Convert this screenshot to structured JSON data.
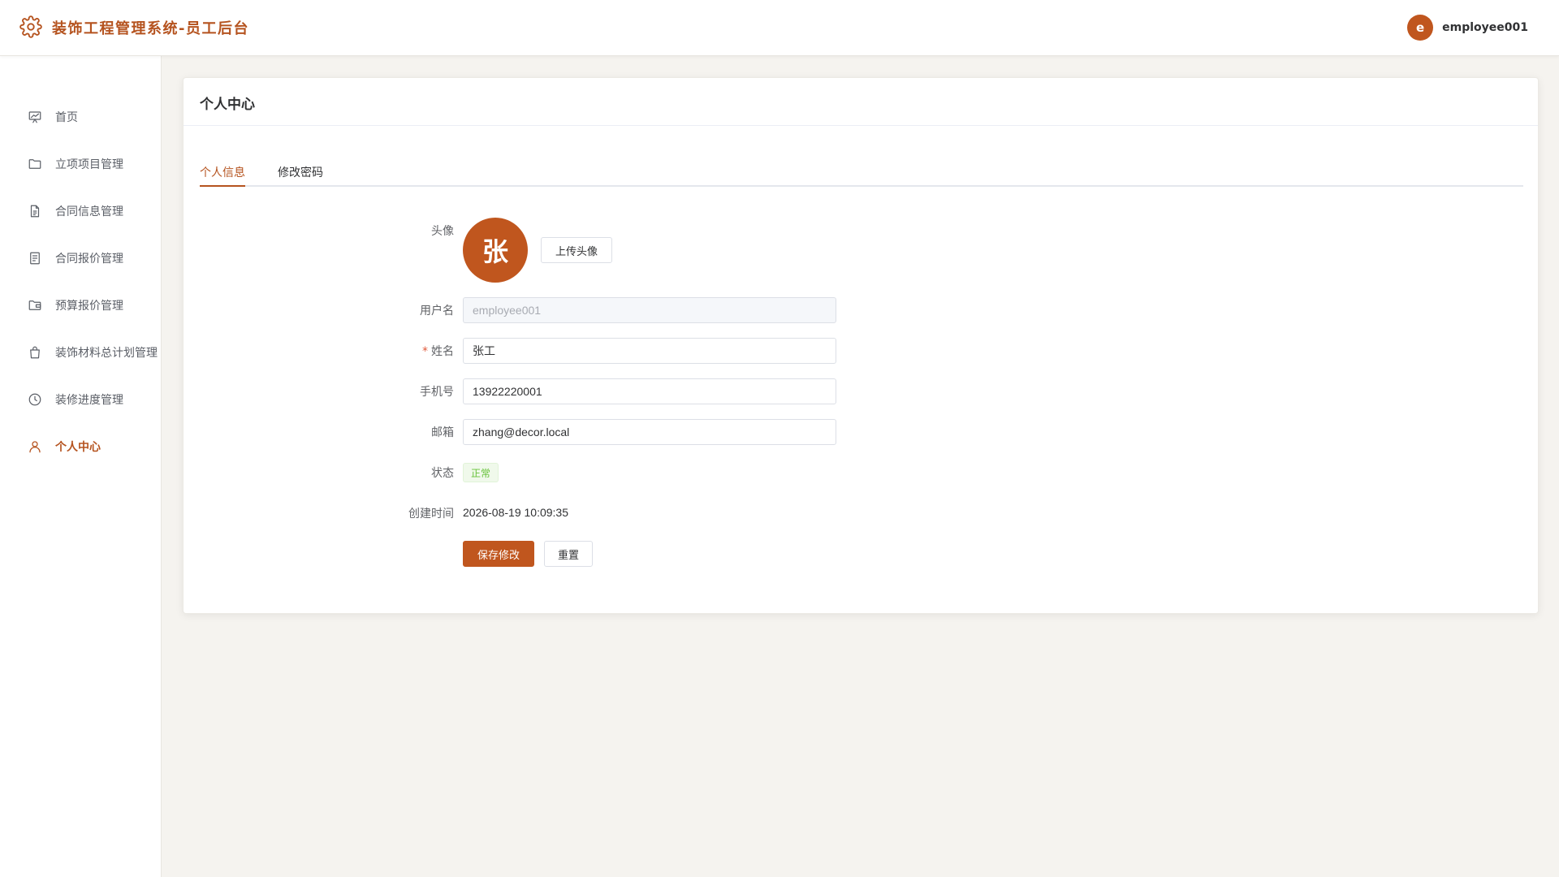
{
  "header": {
    "title": "装饰工程管理系统-员工后台",
    "user_initial": "e",
    "user_name": "employee001",
    "logo_icon": "gear-icon",
    "accent_color": "#b5531f"
  },
  "sidebar": {
    "items": [
      {
        "label": "首页",
        "icon": "chart-board-icon",
        "active": false
      },
      {
        "label": "立项项目管理",
        "icon": "folder-icon",
        "active": false
      },
      {
        "label": "合同信息管理",
        "icon": "document-icon",
        "active": false
      },
      {
        "label": "合同报价管理",
        "icon": "list-document-icon",
        "active": false
      },
      {
        "label": "预算报价管理",
        "icon": "wallet-folder-icon",
        "active": false
      },
      {
        "label": "装饰材料总计划管理",
        "icon": "shopping-bag-icon",
        "active": false
      },
      {
        "label": "装修进度管理",
        "icon": "clock-icon",
        "active": false
      },
      {
        "label": "个人中心",
        "icon": "user-icon",
        "active": true
      }
    ]
  },
  "card": {
    "title": "个人中心",
    "tabs": [
      {
        "label": "个人信息",
        "active": true
      },
      {
        "label": "修改密码",
        "active": false
      }
    ]
  },
  "form": {
    "avatar_label": "头像",
    "avatar_text": "张",
    "upload_button": "上传头像",
    "username_label": "用户名",
    "username_value": "employee001",
    "name_required_mark": "*",
    "name_label": "姓名",
    "name_value": "张工",
    "phone_label": "手机号",
    "phone_value": "13922220001",
    "email_label": "邮箱",
    "email_value": "zhang@decor.local",
    "status_label": "状态",
    "status_value": "正常",
    "status_color": "#67c23a",
    "created_label": "创建时间",
    "created_value": "2026-08-19 10:09:35",
    "save_button": "保存修改",
    "reset_button": "重置"
  }
}
